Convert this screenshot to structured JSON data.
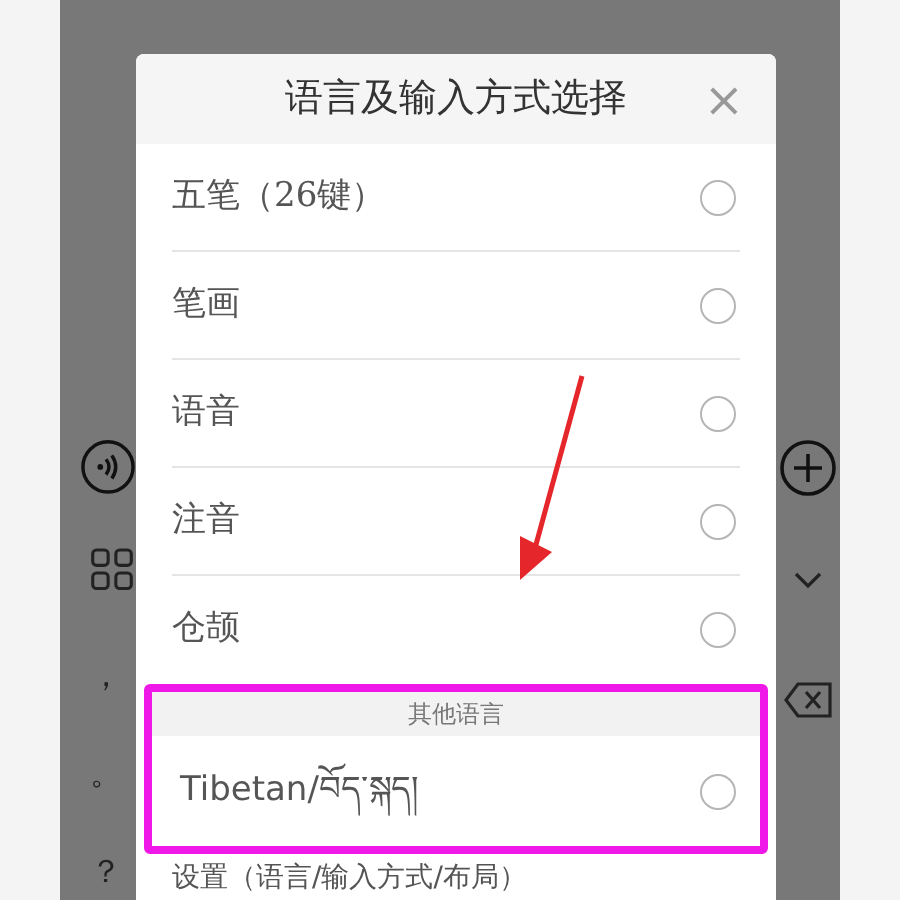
{
  "dialog": {
    "title": "语言及输入方式选择",
    "close": "×",
    "options": [
      {
        "label": "五笔（26键）",
        "selected": false
      },
      {
        "label": "笔画",
        "selected": false
      },
      {
        "label": "语音",
        "selected": false
      },
      {
        "label": "注音",
        "selected": false
      },
      {
        "label": "仓颉",
        "selected": false
      }
    ],
    "section": {
      "title": "其他语言",
      "options": [
        {
          "label": "Tibetan/བོད་སྐད།",
          "selected": false
        }
      ]
    },
    "settings": "设置（语言/输入方式/布局）"
  },
  "keyboard": {
    "left_keys": [
      "，",
      "。",
      "？"
    ]
  }
}
